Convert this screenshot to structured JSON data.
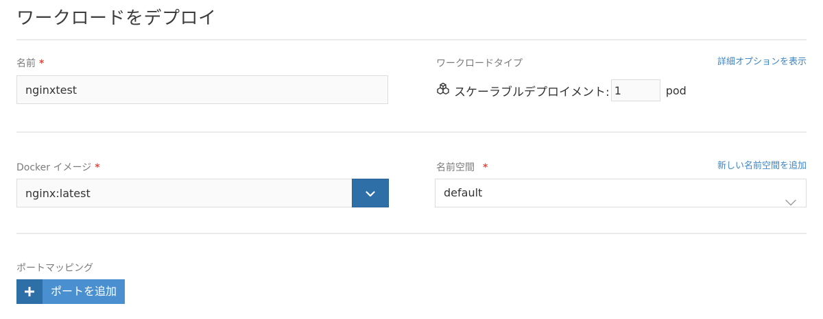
{
  "header": {
    "title": "ワークロードをデプロイ"
  },
  "name": {
    "label": "名前",
    "required_mark": "*",
    "value": "nginxtest"
  },
  "workload_type": {
    "label": "ワークロードタイプ",
    "advanced_link": "詳細オプションを表示",
    "option_label": "スケーラブルデプロイメント:",
    "replicas": "1",
    "unit": "pod",
    "icon": "scalable-deployment-icon"
  },
  "docker_image": {
    "label": "Docker イメージ",
    "required_mark": "*",
    "value": "nginx:latest",
    "dropdown_icon": "chevron-down-icon"
  },
  "namespace": {
    "label": "名前空間",
    "required_mark": "*",
    "add_link": "新しい名前空間を追加",
    "value": "default",
    "icon": "chevron-down-icon"
  },
  "port_mapping": {
    "label": "ポートマッピング",
    "add_button_label": "ポートを追加",
    "add_icon": "plus-icon"
  },
  "colors": {
    "primary": "#2f6fa8",
    "link": "#3d86c6",
    "required": "#e04b3f"
  }
}
